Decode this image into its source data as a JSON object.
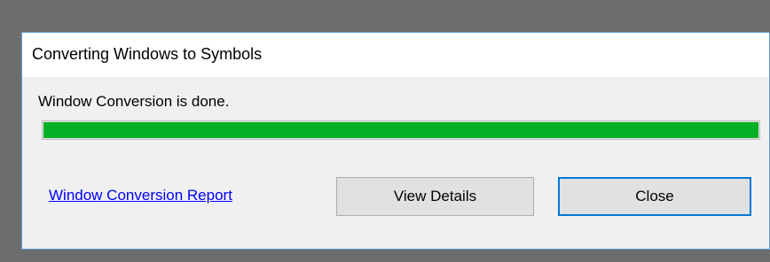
{
  "dialog": {
    "title": "Converting Windows to Symbols",
    "status": "Window Conversion is done.",
    "progress": {
      "percent": 100,
      "color": "#06b025"
    },
    "report_link": "Window Conversion Report",
    "buttons": {
      "view_details": "View Details",
      "close": "Close"
    },
    "accent_color": "#0078d7"
  }
}
